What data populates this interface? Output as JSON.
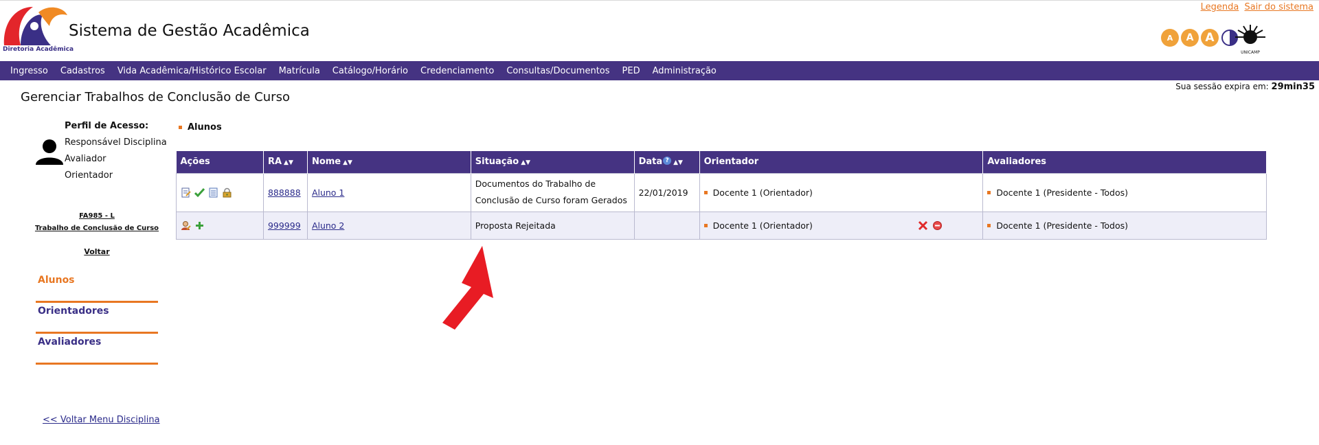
{
  "header": {
    "title": "Sistema de Gestão Acadêmica",
    "logo_subtitle": "Diretoria Acadêmica",
    "top_links": [
      "Legenda",
      "Sair do sistema"
    ],
    "a11y_labels": [
      "A",
      "A",
      "A"
    ],
    "unicamp_label": "UNICAMP"
  },
  "menu": [
    "Ingresso",
    "Cadastros",
    "Vida Acadêmica/Histórico Escolar",
    "Matrícula",
    "Catálogo/Horário",
    "Credenciamento",
    "Consultas/Documentos",
    "PED",
    "Administração"
  ],
  "session": {
    "label": "Sua sessão expira em:",
    "value": "29min35"
  },
  "page_title": "Gerenciar Trabalhos de Conclusão de Curso",
  "sidebar": {
    "profile_label": "Perfil de Acesso:",
    "profiles": [
      "Responsável Disciplina",
      "Avaliador",
      "Orientador"
    ],
    "course_code": "FA985 - L",
    "course_name": "Trabalho de Conclusão de Curso",
    "back": "Voltar",
    "nav": [
      {
        "label": "Alunos",
        "active": true
      },
      {
        "label": "Orientadores",
        "active": false
      },
      {
        "label": "Avaliadores",
        "active": false
      }
    ],
    "back_menu": "<< Voltar Menu Disciplina"
  },
  "main": {
    "section": "Alunos",
    "columns": [
      "Ações",
      "RA",
      "Nome",
      "Situação",
      "Data",
      "Orientador",
      "Avaliadores"
    ],
    "rows": [
      {
        "ra": "888888",
        "nome": "Aluno 1",
        "situacao_l1": "Documentos do Trabalho de",
        "situacao_l2": "Conclusão de Curso foram Gerados",
        "data": "22/01/2019",
        "orientador": "Docente 1 (Orientador)",
        "avaliadores": "Docente 1 (Presidente - Todos)"
      },
      {
        "ra": "999999",
        "nome": "Aluno 2",
        "situacao_l1": "Proposta Rejeitada",
        "data": "",
        "orientador": "Docente 1 (Orientador)",
        "avaliadores": "Docente 1 (Presidente - Todos)"
      }
    ]
  },
  "colors": {
    "menu_bg": "#453382",
    "accent": "#e87722",
    "link": "#2a2a8a"
  }
}
